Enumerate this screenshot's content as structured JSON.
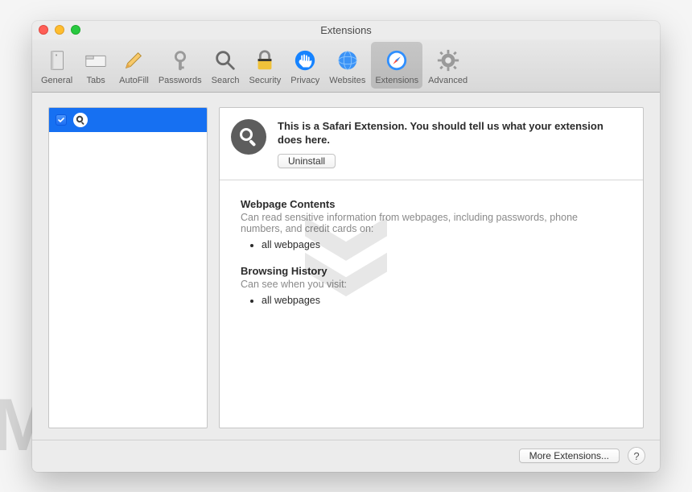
{
  "window": {
    "title": "Extensions"
  },
  "toolbar": {
    "items": [
      {
        "label": "General"
      },
      {
        "label": "Tabs"
      },
      {
        "label": "AutoFill"
      },
      {
        "label": "Passwords"
      },
      {
        "label": "Search"
      },
      {
        "label": "Security"
      },
      {
        "label": "Privacy"
      },
      {
        "label": "Websites"
      },
      {
        "label": "Extensions"
      },
      {
        "label": "Advanced"
      }
    ]
  },
  "sidebar": {
    "selected_enabled": true
  },
  "detail": {
    "description": "This is a Safari Extension. You should tell us what your extension does here.",
    "uninstall_label": "Uninstall",
    "sections": {
      "webpage": {
        "title": "Webpage Contents",
        "sub": "Can read sensitive information from webpages, including passwords, phone numbers, and credit cards on:",
        "bullet": "all webpages"
      },
      "history": {
        "title": "Browsing History",
        "sub": "Can see when you visit:",
        "bullet": "all webpages"
      }
    }
  },
  "footer": {
    "more_label": "More Extensions...",
    "help_label": "?"
  },
  "watermark": "MALWARETIPS"
}
